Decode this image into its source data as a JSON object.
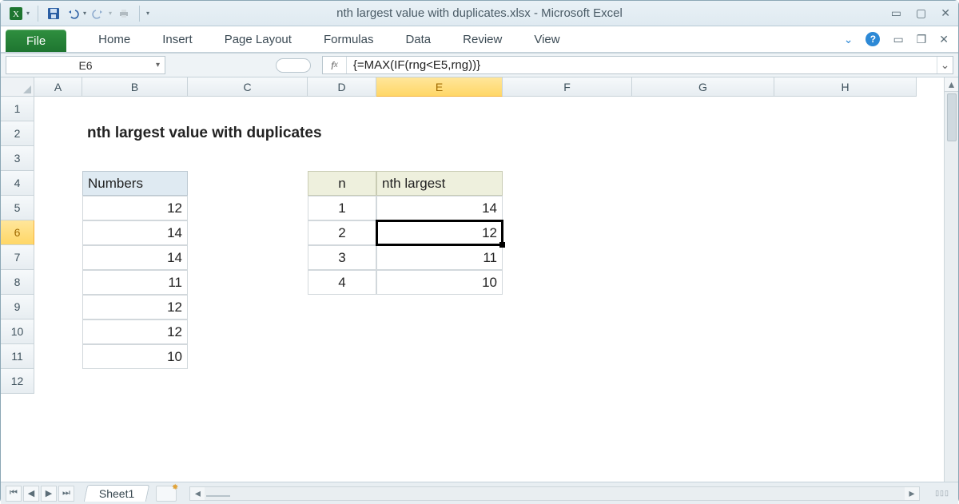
{
  "window": {
    "title": "nth largest value with duplicates.xlsx  -  Microsoft Excel"
  },
  "ribbon": {
    "file": "File",
    "tabs": [
      "Home",
      "Insert",
      "Page Layout",
      "Formulas",
      "Data",
      "Review",
      "View"
    ]
  },
  "namebox": "E6",
  "formula": "{=MAX(IF(rng<E5,rng))}",
  "columns": [
    "A",
    "B",
    "C",
    "D",
    "E",
    "F",
    "G",
    "H"
  ],
  "active_col": "E",
  "row_count": 12,
  "active_row": 6,
  "title_cell": "nth largest value with duplicates",
  "tbl_numbers": {
    "header": "Numbers",
    "values": [
      "12",
      "14",
      "14",
      "11",
      "12",
      "12",
      "10"
    ]
  },
  "tbl_nth": {
    "headers": {
      "n": "n",
      "nth": "nth largest"
    },
    "rows": [
      {
        "n": "1",
        "v": "14"
      },
      {
        "n": "2",
        "v": "12"
      },
      {
        "n": "3",
        "v": "11"
      },
      {
        "n": "4",
        "v": "10"
      }
    ]
  },
  "sheet_tab": "Sheet1"
}
